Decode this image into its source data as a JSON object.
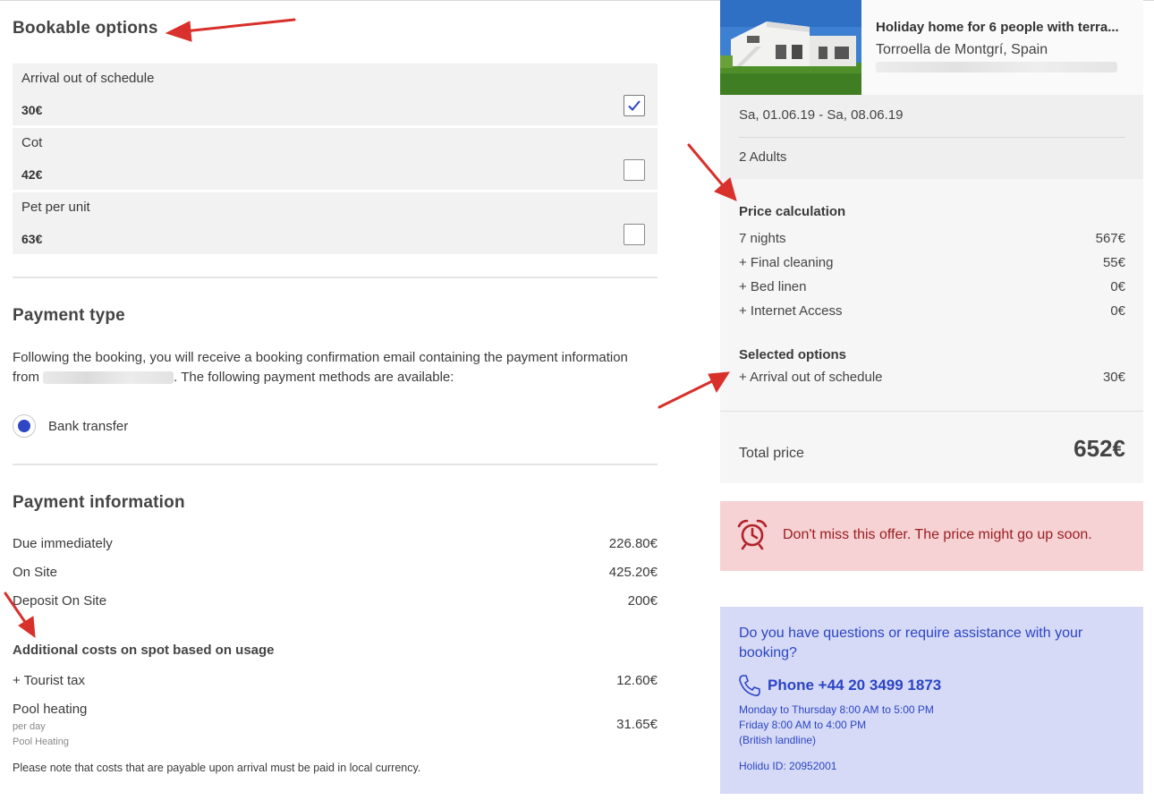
{
  "bookable_options": {
    "title": "Bookable options",
    "items": [
      {
        "name": "Arrival out of schedule",
        "price": "30€",
        "checked": true
      },
      {
        "name": "Cot",
        "price": "42€",
        "checked": false
      },
      {
        "name": "Pet per unit",
        "price": "63€",
        "checked": false
      }
    ]
  },
  "payment_type": {
    "title": "Payment type",
    "desc_part1": "Following the booking, you will receive a booking confirmation email containing the payment information from ",
    "desc_part2": ". The following payment methods are available:",
    "method_label": "Bank transfer"
  },
  "payment_info": {
    "title": "Payment information",
    "rows": [
      {
        "label": "Due immediately",
        "value": "226.80€"
      },
      {
        "label": "On Site",
        "value": "425.20€"
      },
      {
        "label": "Deposit On Site",
        "value": "200€"
      }
    ],
    "additional_title": "Additional costs on spot based on usage",
    "tourist_tax": {
      "label": "+ Tourist tax",
      "value": "12.60€"
    },
    "pool_heating": {
      "label": "Pool heating",
      "per": "per day",
      "sub": "Pool Heating",
      "value": "31.65€"
    },
    "note": "Please note that costs that are payable upon arrival must be paid in local currency."
  },
  "property": {
    "title": "Holiday home for 6 people with terra...",
    "location": "Torroella de Montgrí, Spain",
    "dates": "Sa, 01.06.19 - Sa, 08.06.19",
    "guests": "2 Adults"
  },
  "price_calc": {
    "title": "Price calculation",
    "rows": [
      {
        "label": "7 nights",
        "value": "567€"
      },
      {
        "label": "+ Final cleaning",
        "value": "55€"
      },
      {
        "label": "+ Bed linen",
        "value": "0€"
      },
      {
        "label": "+ Internet Access",
        "value": "0€"
      }
    ],
    "selected_title": "Selected options",
    "selected_rows": [
      {
        "label": "+ Arrival out of schedule",
        "value": "30€"
      }
    ],
    "total_label": "Total price",
    "total_value": "652€"
  },
  "offer": {
    "text": "Don't miss this offer. The price might go up soon.",
    "icon": "alarm-clock-icon"
  },
  "help": {
    "question": "Do you have questions or require assistance with your booking?",
    "phone": "Phone +44 20 3499 1873",
    "hours1": "Monday to Thursday 8:00 AM to 5:00 PM",
    "hours2": "Friday 8:00 AM to 4:00 PM",
    "landline": "(British landline)",
    "holidu_id": "Holidu ID: 20952001",
    "icon": "phone-icon"
  },
  "colors": {
    "accent_blue": "#2b45c4",
    "offer_bg": "#f6d2d4",
    "offer_text": "#9b1e22",
    "help_bg": "#d6daf6",
    "arrow_red": "#d8302a"
  }
}
